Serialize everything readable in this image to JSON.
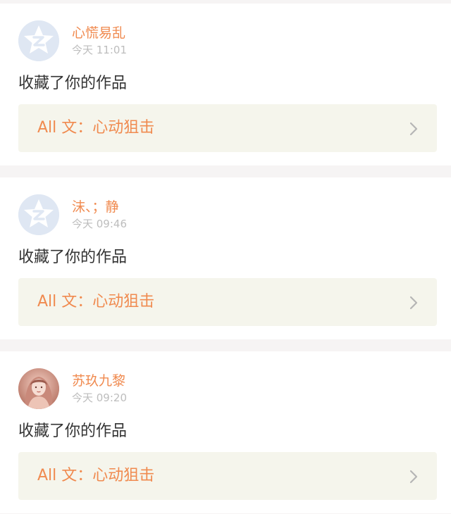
{
  "notifications": [
    {
      "username": "心慌易乱",
      "time": "今天 11:01",
      "action": "收藏了你的作品",
      "work": "All 文：心动狙击",
      "avatar": "default-avatar-icon"
    },
    {
      "username": "沫、；静",
      "time": "今天 09:46",
      "action": "收藏了你的作品",
      "work": "All 文：心动狙击",
      "avatar": "default-avatar-icon"
    },
    {
      "username": "苏玖九黎",
      "time": "今天 09:20",
      "action": "收藏了你的作品",
      "work": "All 文：心动狙击",
      "avatar": "user-photo"
    }
  ],
  "colors": {
    "accent": "#f08a4f",
    "card_link_bg": "#f5f5ec",
    "separator_bg": "#f6f4f4",
    "time_text": "#bdbdbd",
    "body_text": "#333333"
  }
}
